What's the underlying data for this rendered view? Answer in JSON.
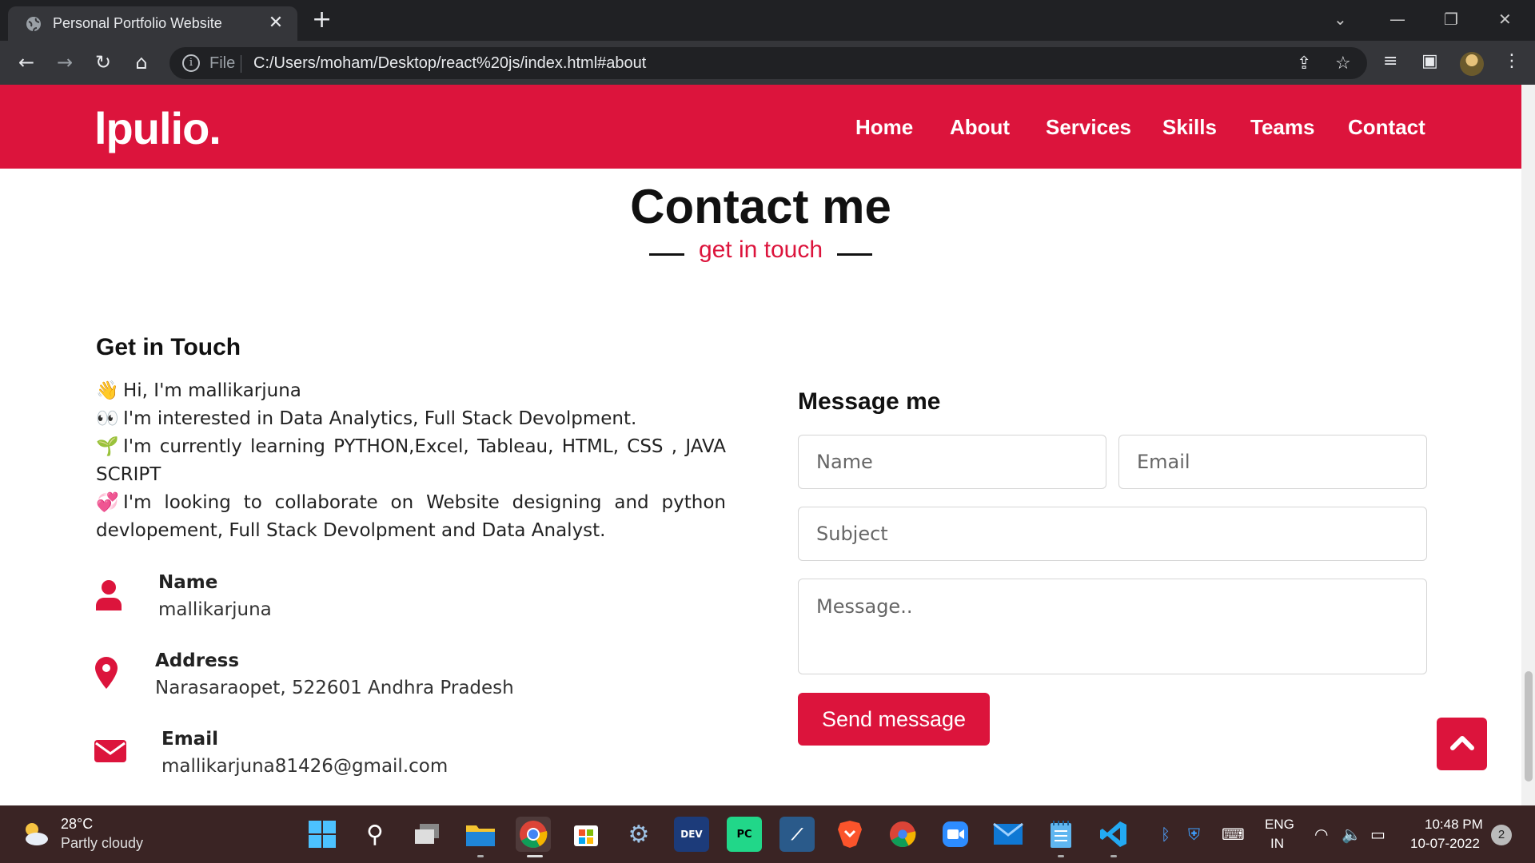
{
  "browser": {
    "tab_title": "Personal Portfolio Website",
    "omnibox_scheme": "File",
    "url": "C:/Users/moham/Desktop/react%20js/index.html#about"
  },
  "site": {
    "logo": "lpulio.",
    "nav": [
      "Home",
      "About",
      "Services",
      "Skills",
      "Teams",
      "Contact"
    ],
    "accent_color": "#dc143c"
  },
  "contact": {
    "title": "Contact me",
    "subtitle": "get in touch",
    "left_heading": "Get in Touch",
    "about_lines": [
      {
        "emoji": "👋",
        "text": "Hi, I'm mallikarjuna"
      },
      {
        "emoji": "👀",
        "text": "I'm interested in Data Analytics, Full Stack Devolpment."
      },
      {
        "emoji": "🌱",
        "text": "I'm currently learning PYTHON,Excel, Tableau, HTML, CSS , JAVA SCRIPT"
      },
      {
        "emoji": "💞",
        "text": "I'm looking to collaborate on Website designing and python devlopement, Full Stack Devolpment and Data Analyst."
      }
    ],
    "info": [
      {
        "head": "Name",
        "value": "mallikarjuna",
        "icon": "user-icon"
      },
      {
        "head": "Address",
        "value": "Narasaraopet, 522601 Andhra Pradesh",
        "icon": "map-marker-icon"
      },
      {
        "head": "Email",
        "value": "mallikarjuna81426@gmail.com",
        "icon": "envelope-icon"
      }
    ],
    "form": {
      "heading": "Message me",
      "name_placeholder": "Name",
      "email_placeholder": "Email",
      "subject_placeholder": "Subject",
      "message_placeholder": "Message..",
      "send_label": "Send message"
    }
  },
  "taskbar": {
    "temp": "28°C",
    "weather": "Partly cloudy",
    "lang_1": "ENG",
    "lang_2": "IN",
    "time": "10:48 PM",
    "date": "10-07-2022",
    "notifications": "2"
  }
}
